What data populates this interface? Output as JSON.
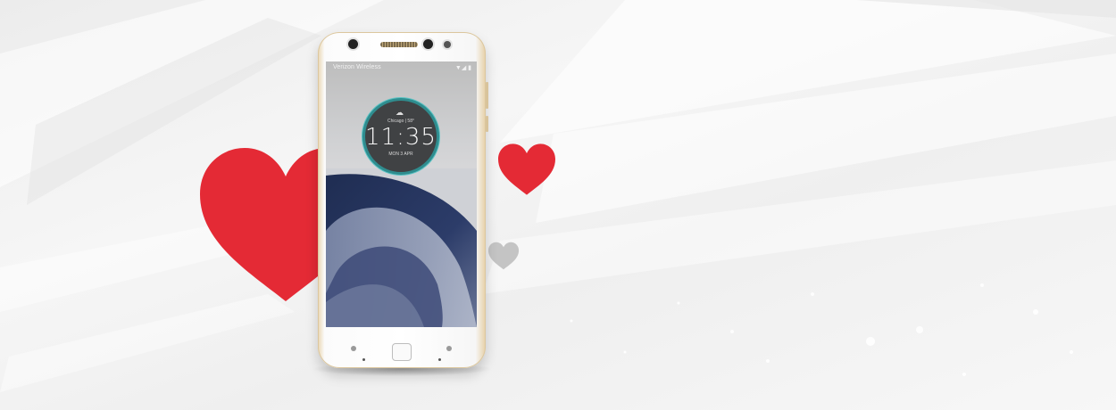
{
  "phone": {
    "carrier": "Verizon Wireless",
    "status_icons": "▼◢ ▮",
    "clock": {
      "city_line": "Chicago | 58°",
      "time": "11:35",
      "date_line": "MON  3  APR"
    }
  },
  "colors": {
    "heart_red": "#e42a35",
    "heart_gray": "#c4c4c4",
    "accent_teal": "#2f8d8f",
    "phone_trim_gold": "#d8c39b"
  },
  "icons": {
    "weather": "cloud-sun-icon",
    "home": "home-button-icon"
  }
}
